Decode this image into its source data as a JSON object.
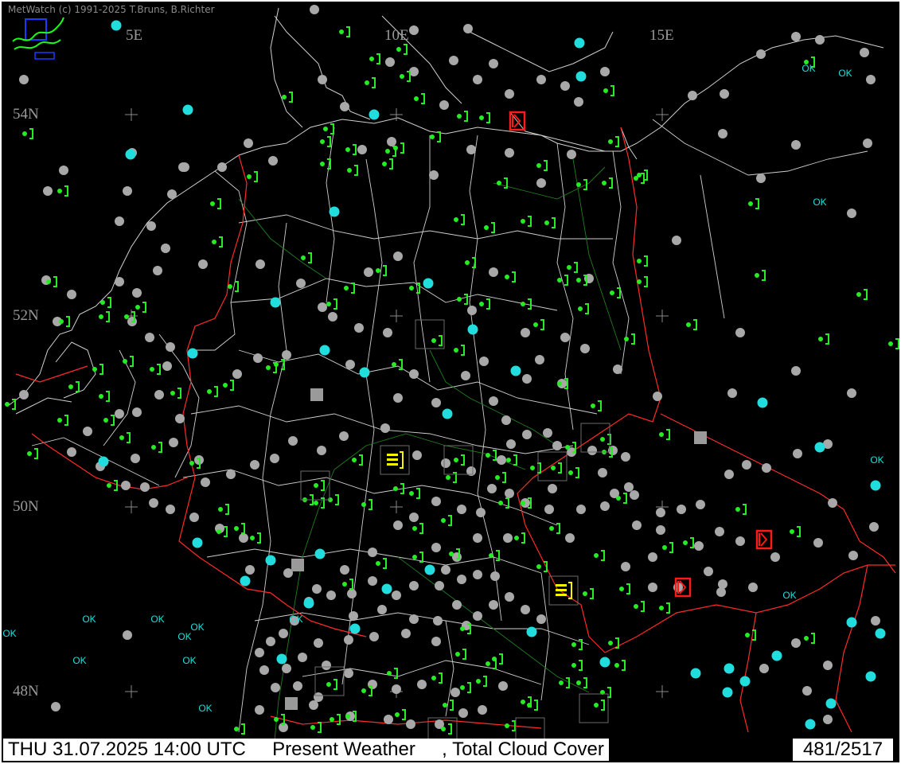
{
  "header": {
    "credit": "MetWatch  (c) 1991-2025 T.Bruns, B.Richter"
  },
  "graticule": {
    "lon_labels": [
      "5E",
      "10E",
      "15E"
    ],
    "lat_labels": [
      "54N",
      "52N",
      "50N",
      "48N"
    ]
  },
  "legend_text": {
    "ok": "OK"
  },
  "status": {
    "datetime": "THU 31.07.2025 14:00 UTC",
    "product": "Present Weather",
    "overlay": ", Total Cloud Cover",
    "station_count": "481/2517"
  },
  "colors": {
    "background": "#000000",
    "coast_border": "#d8d8d8",
    "national_border": "#ff2a2a",
    "river": "#1f8f1f",
    "precip_symbol": "#22ee22",
    "thunder_symbol": "#ff1a1a",
    "fog_symbol": "#f5f500",
    "clear_sky": "#22dddd",
    "cloud_marker": "#a8a8a8"
  },
  "icons": {
    "logo": "metwatch-logo-icon",
    "precip": "shower-rain-icon",
    "thunder": "thunderstorm-icon",
    "fog": "fog-icon",
    "clear": "clear-sky-icon",
    "cloud": "cloud-cover-icon"
  }
}
